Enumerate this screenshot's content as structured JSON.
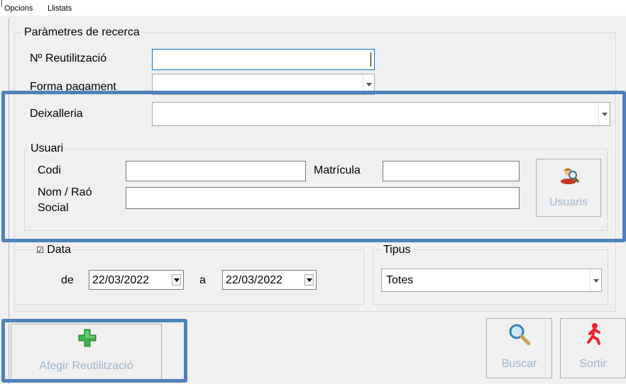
{
  "menu": {
    "items": [
      "Opcions",
      "Llistats"
    ]
  },
  "search": {
    "legend": "Paràmetres de recerca",
    "reutilitzacio_label": "Nº Reutilització",
    "reutilitzacio_value": "",
    "forma_pagament_label": "Forma pagament",
    "forma_pagament_value": "",
    "deixalleria_label": "Deixalleria",
    "deixalleria_value": ""
  },
  "usuari": {
    "legend": "Usuari",
    "codi_label": "Codi",
    "codi_value": "",
    "matricula_label": "Matrícula",
    "matricula_value": "",
    "nom_label_line1": "Nom / Raó",
    "nom_label_line2": "Social",
    "nom_value": "",
    "usuaris_button": "Usuaris"
  },
  "data": {
    "legend": "Data",
    "checked": true,
    "checkbox_glyph": "☑",
    "from_label": "de",
    "from_value": "22/03/2022",
    "to_label": "a",
    "to_value": "22/03/2022"
  },
  "tipus": {
    "legend": "Tipus",
    "value": "Totes"
  },
  "buttons": {
    "afegir": "Afegir Reutilització",
    "buscar": "Buscar",
    "sortir": "Sortir"
  },
  "colors": {
    "highlight": "#4f81bd",
    "disabled_text": "#9fb6cc"
  },
  "icons": [
    "add-plus-icon",
    "magnifier-icon",
    "user-search-icon",
    "running-man-icon"
  ]
}
